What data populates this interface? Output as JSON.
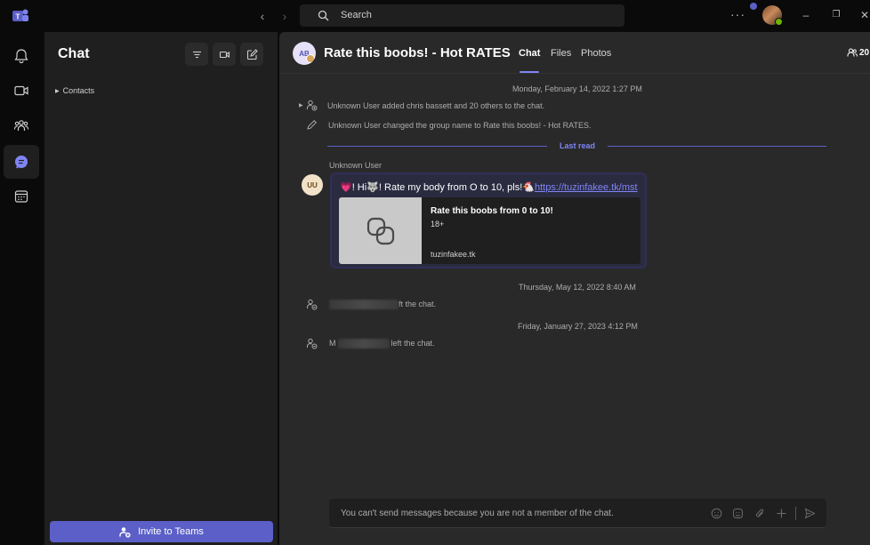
{
  "topbar": {
    "search_placeholder": "Search",
    "more_label": "···"
  },
  "rail": {
    "items": [
      "bell-icon",
      "video-icon",
      "people-icon",
      "chat-icon",
      "calendar-icon"
    ],
    "active": "chat-icon"
  },
  "left_pane": {
    "title": "Chat",
    "contacts_label": "Contacts",
    "invite_button": "Invite to Teams"
  },
  "chat": {
    "avatar_initials": "AB",
    "title": "Rate this boobs! - Hot RATES",
    "tabs": [
      {
        "label": "Chat",
        "active": true
      },
      {
        "label": "Files",
        "active": false
      },
      {
        "label": "Photos",
        "active": false
      }
    ],
    "participant_count": "20",
    "timeline": {
      "timestamp_1": "Monday, February 14, 2022 1:27 PM",
      "event_added": "Unknown User added chris bassett and 20 others to the chat.",
      "event_renamed": "Unknown User changed the group name to Rate this boobs! - Hot RATES.",
      "last_read": "Last read",
      "sender": "Unknown User",
      "sender_initials": "UU",
      "message_prefix": "💗! Hi🐺! Rate my body from O to 10, pls!🐔",
      "message_link": "https://tuzinfakee.tk/mst",
      "preview_title": "Rate this boobs from 0 to 10!",
      "preview_subtitle": "18+",
      "preview_domain": "tuzinfakee.tk",
      "timestamp_2": "Thursday, May 12, 2022 8:40 AM",
      "event_left_1_suffix": "ft the chat.",
      "timestamp_3": "Friday, January 27, 2023 4:12 PM",
      "event_left_2_prefix": "M",
      "event_left_2_suffix": "left the chat."
    },
    "composer_text": "You can't send messages because you are not a member of the chat."
  },
  "colors": {
    "accent": "#5b5fc7",
    "accent_light": "#7f85f5",
    "background": "#292929",
    "pane": "#1f1f1f",
    "presence": "#6bb700"
  }
}
